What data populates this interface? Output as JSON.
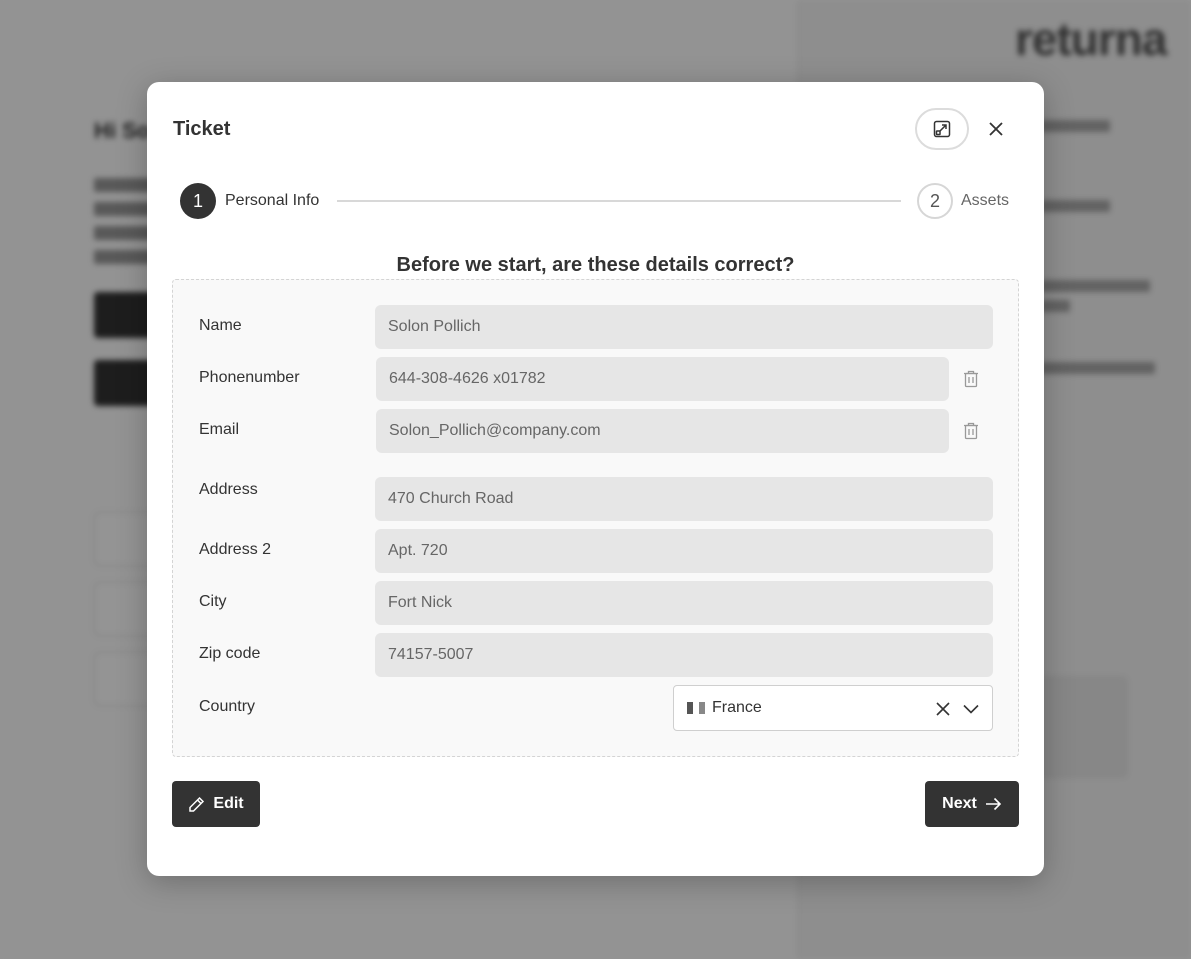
{
  "background": {
    "brand": "returna",
    "greeting": "Hi So"
  },
  "modal": {
    "title": "Ticket",
    "expand_icon": "open-in-new-icon",
    "close_icon": "close-icon"
  },
  "stepper": {
    "steps": [
      {
        "number": "1",
        "label": "Personal Info",
        "active": true
      },
      {
        "number": "2",
        "label": "Assets",
        "active": false
      }
    ]
  },
  "form": {
    "question": "Before we start, are these details correct?",
    "fields": {
      "name": {
        "label": "Name",
        "value": "Solon Pollich"
      },
      "phone": {
        "label": "Phonenumber",
        "value": "644-308-4626 x01782"
      },
      "email": {
        "label": "Email",
        "value": "Solon_Pollich@company.com"
      },
      "address": {
        "label": "Address",
        "value": "470 Church Road"
      },
      "address2": {
        "label": "Address 2",
        "value": "Apt. 720"
      },
      "city": {
        "label": "City",
        "value": "Fort Nick"
      },
      "zip": {
        "label": "Zip code",
        "value": "74157-5007"
      },
      "country": {
        "label": "Country",
        "value": "France"
      }
    }
  },
  "actions": {
    "edit_label": "Edit",
    "next_label": "Next"
  },
  "colors": {
    "primary": "#333333",
    "field_bg": "#e6e6e6",
    "overlay": "rgba(0,0,0,0.42)"
  }
}
